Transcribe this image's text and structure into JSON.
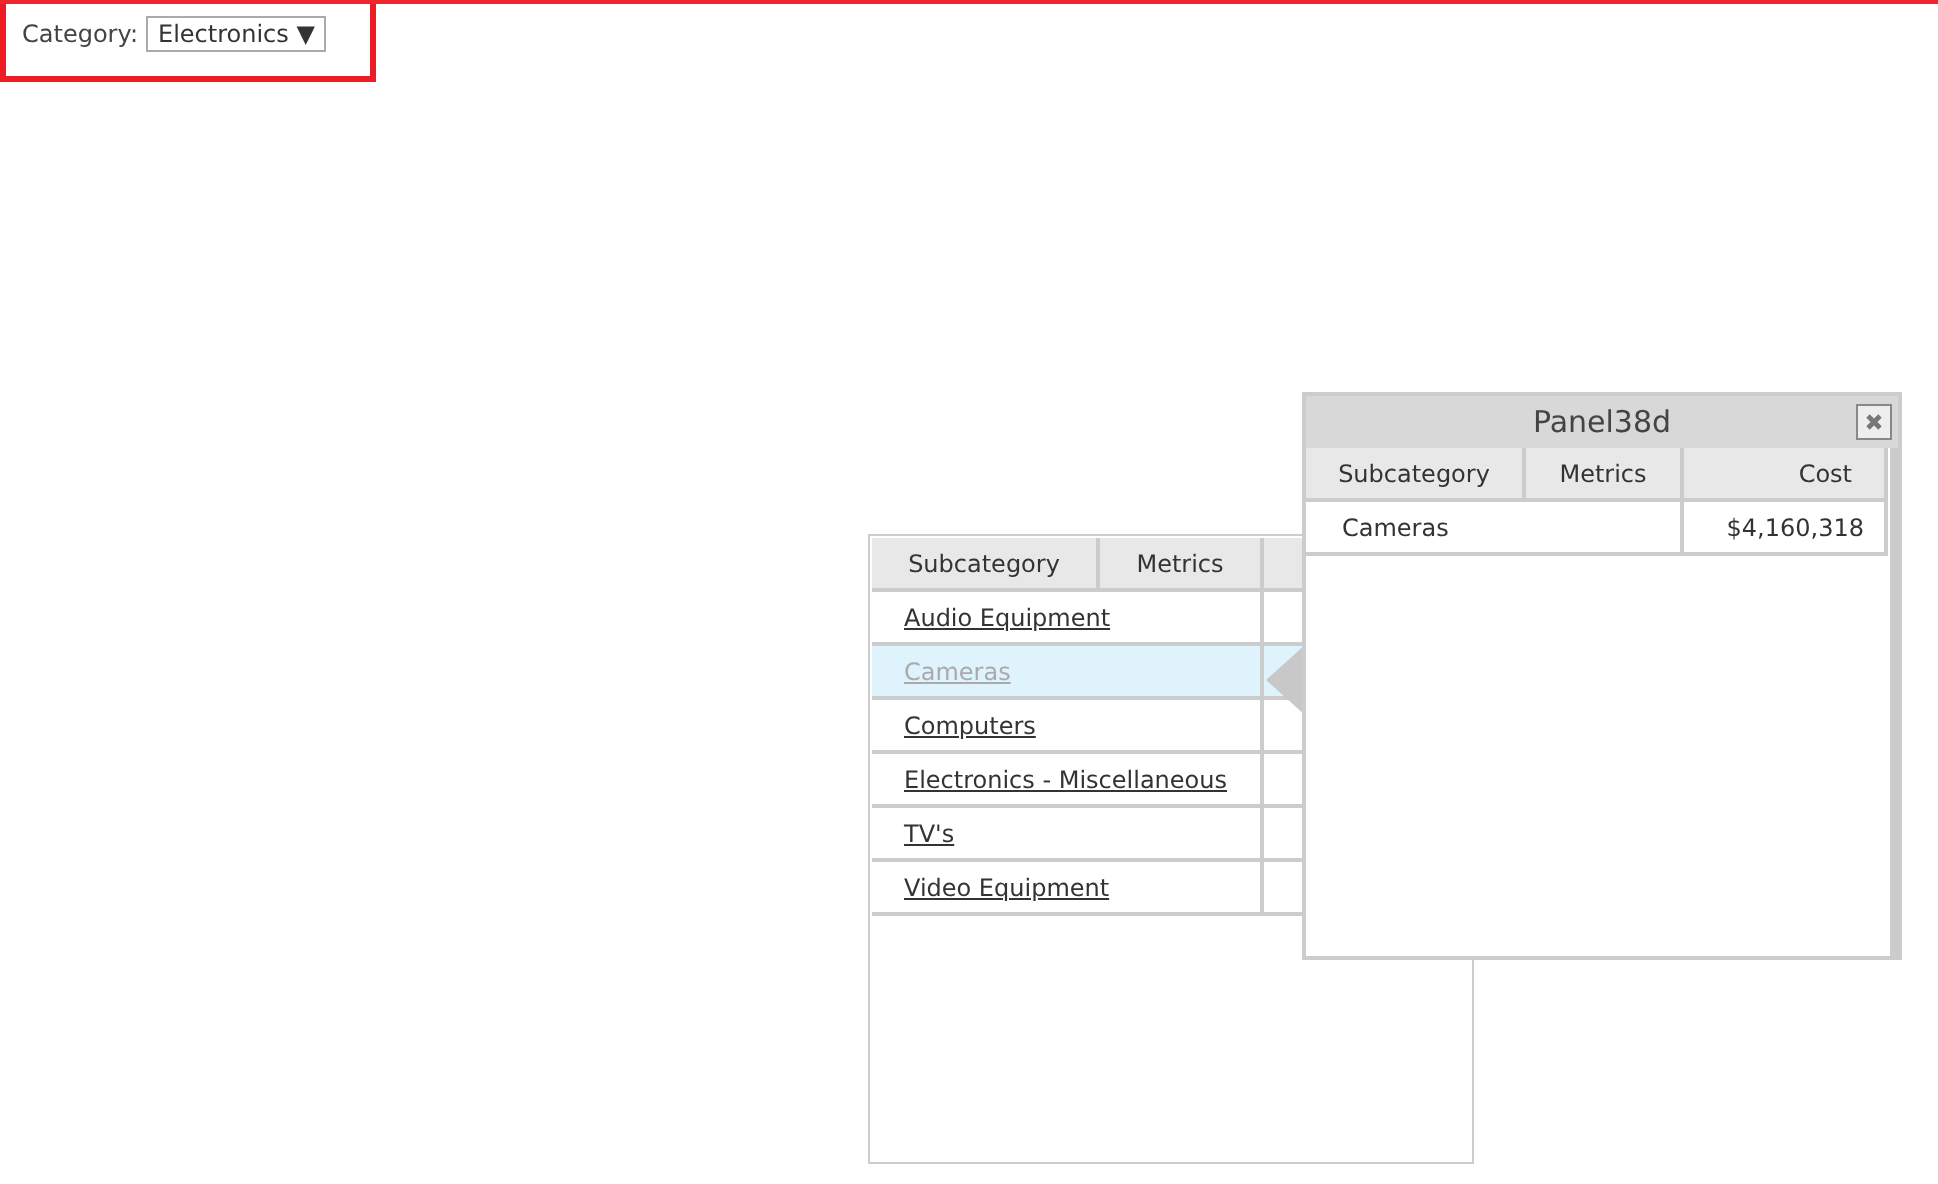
{
  "filter": {
    "label": "Category:",
    "value": "Electronics",
    "caret": "▼"
  },
  "table": {
    "columns": [
      "Subcategory",
      "Metrics"
    ],
    "rows": [
      {
        "subcategory": "Audio Equipment",
        "selected": false
      },
      {
        "subcategory": "Cameras",
        "selected": true
      },
      {
        "subcategory": "Computers",
        "selected": false
      },
      {
        "subcategory": "Electronics - Miscellaneous",
        "selected": false
      },
      {
        "subcategory": "TV's",
        "selected": false
      },
      {
        "subcategory": "Video Equipment",
        "selected": false
      }
    ]
  },
  "panel": {
    "title": "Panel38d",
    "columns": [
      "Subcategory",
      "Metrics",
      "Cost"
    ],
    "rows": [
      {
        "subcategory": "Cameras",
        "metrics_": "",
        "cost": "$4,160,318"
      }
    ]
  }
}
